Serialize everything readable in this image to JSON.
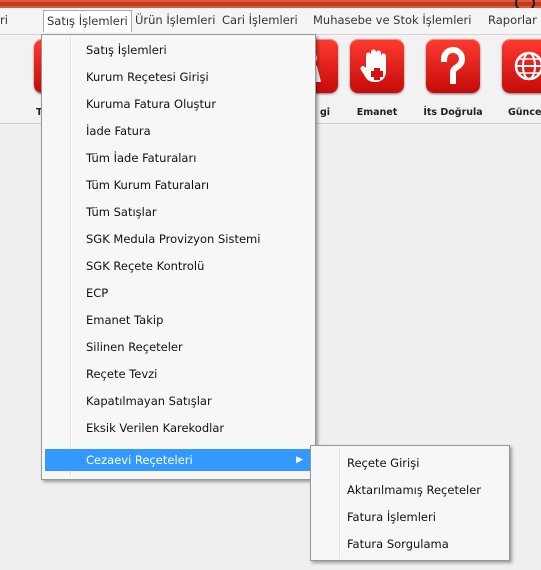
{
  "menubar": {
    "items": [
      {
        "label": "ri"
      },
      {
        "label": "Satış İşlemleri"
      },
      {
        "label": "Ürün İşlemleri"
      },
      {
        "label": "Cari İşlemleri"
      },
      {
        "label": "Muhasebe ve Stok İşlemleri"
      },
      {
        "label": "Raporlar"
      }
    ]
  },
  "toolbar": {
    "buttons": [
      {
        "label": "T",
        "icon": "red-button-icon"
      },
      {
        "label": "gi",
        "icon": "person-icon"
      },
      {
        "label": "Emanet",
        "icon": "hand-icon"
      },
      {
        "label": "İts Doğrula",
        "icon": "question-icon"
      },
      {
        "label": "Günce",
        "icon": "globe-icon"
      }
    ]
  },
  "menu": {
    "items": [
      {
        "label": "Satış İşlemleri"
      },
      {
        "label": "Kurum Reçetesi Girişi"
      },
      {
        "label": "Kuruma Fatura Oluştur"
      },
      {
        "label": "İade Fatura"
      },
      {
        "label": "Tüm İade Faturaları"
      },
      {
        "label": "Tüm Kurum Faturaları"
      },
      {
        "label": "Tüm Satışlar"
      },
      {
        "label": "SGK Medula Provizyon Sistemi"
      },
      {
        "label": "SGK Reçete Kontrolü"
      },
      {
        "label": "ECP"
      },
      {
        "label": "Emanet Takip"
      },
      {
        "label": "Silinen Reçeteler"
      },
      {
        "label": "Reçete Tevzi"
      },
      {
        "label": "Kapatılmayan Satışlar"
      },
      {
        "label": "Eksik Verilen Karekodlar"
      },
      {
        "label": "Cezaevi Reçeteleri",
        "highlighted": true,
        "has_submenu": true
      }
    ]
  },
  "submenu": {
    "items": [
      {
        "label": "Reçete Girişi"
      },
      {
        "label": "Aktarılmamış Reçeteler"
      },
      {
        "label": "Fatura İşlemleri"
      },
      {
        "label": "Fatura Sorgulama"
      }
    ]
  },
  "colors": {
    "highlight": "#3399ff",
    "toolbar_icon_red": "#e01b1b"
  }
}
